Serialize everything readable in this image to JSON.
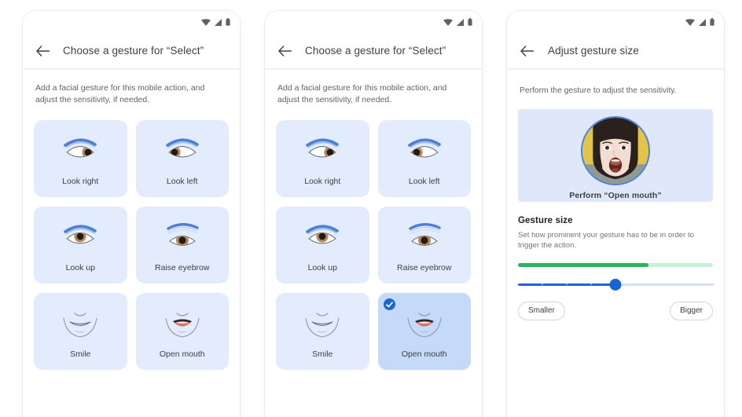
{
  "colors": {
    "card_bg": "#e3ecfd",
    "card_selected_bg": "#c5d9f8",
    "accent_blue": "#1967d2",
    "meter_green": "#28b45c",
    "meter_green_track": "#c9f0d8",
    "slider_blue": "#1a65d6",
    "preview_bg": "#dfe8fb",
    "face_ring": "#4b7fe0"
  },
  "statusbar": {
    "icons": [
      "wifi-icon",
      "signal-icon",
      "battery-icon"
    ]
  },
  "panels": [
    {
      "id": "choose-gesture-unselected",
      "appbar": {
        "back_icon": "back-arrow-icon",
        "title": "Choose a gesture for “Select”"
      },
      "intro": "Add a facial gesture for this mobile action, and adjust the sensitivity, if needed.",
      "gestures": [
        {
          "label": "Look right",
          "art": "eye-look-right",
          "selected": false
        },
        {
          "label": "Look left",
          "art": "eye-look-left",
          "selected": false
        },
        {
          "label": "Look up",
          "art": "eye-look-up",
          "selected": false
        },
        {
          "label": "Raise eyebrow",
          "art": "eye-raise-eyebrow",
          "selected": false
        },
        {
          "label": "Smile",
          "art": "mouth-smile",
          "selected": false
        },
        {
          "label": "Open mouth",
          "art": "mouth-open",
          "selected": false
        }
      ]
    },
    {
      "id": "choose-gesture-selected",
      "appbar": {
        "back_icon": "back-arrow-icon",
        "title": "Choose a gesture for “Select”"
      },
      "intro": "Add a facial gesture for this mobile action, and adjust the sensitivity, if needed.",
      "gestures": [
        {
          "label": "Look right",
          "art": "eye-look-right",
          "selected": false
        },
        {
          "label": "Look left",
          "art": "eye-look-left",
          "selected": false
        },
        {
          "label": "Look up",
          "art": "eye-look-up",
          "selected": false
        },
        {
          "label": "Raise eyebrow",
          "art": "eye-raise-eyebrow",
          "selected": false
        },
        {
          "label": "Smile",
          "art": "mouth-smile",
          "selected": false
        },
        {
          "label": "Open mouth",
          "art": "mouth-open",
          "selected": true
        }
      ]
    }
  ],
  "adjust": {
    "appbar": {
      "back_icon": "back-arrow-icon",
      "title": "Adjust gesture size"
    },
    "intro": "Perform the gesture to adjust the sensitivity.",
    "preview": {
      "caption": "Perform “Open mouth”",
      "art": "face-open-mouth-photo"
    },
    "section_title": "Gesture size",
    "section_desc": "Set how prominent your gesture has to be in order to trigger the action.",
    "meter": {
      "value_percent": 67
    },
    "slider": {
      "value_percent": 50,
      "tick_count": 9
    },
    "smaller_label": "Smaller",
    "bigger_label": "Bigger"
  }
}
